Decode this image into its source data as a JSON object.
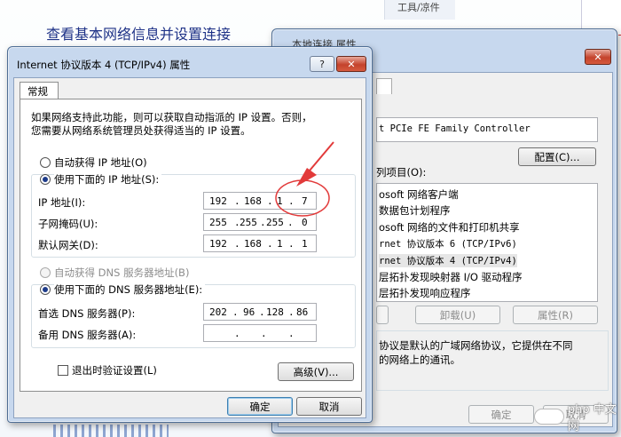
{
  "background": {
    "heading": "查看基本网络信息并设置连接",
    "right_panel_label": "工具/凉件"
  },
  "back_window": {
    "title": "本地连接 属性",
    "title_fragment": "性",
    "adapter_name": "t PCIe FE Family Controller",
    "configure_button": "配置(C)...",
    "items_label": "列项目(O):",
    "items": [
      "osoft 网络客户端",
      "数据包计划程序",
      "osoft 网络的文件和打印机共享",
      "rnet 协议版本 6 (TCP/IPv6)",
      "rnet 协议版本 4 (TCP/IPv4)",
      "层拓扑发现映射器 I/O 驱动程序",
      "层拓扑发现响应程序"
    ],
    "uninstall_button": "卸载(U)",
    "properties_button": "属性(R)",
    "description_line1": "协议是默认的广域网络协议，它提供在不同",
    "description_line2": "的网络上的通讯。",
    "ok_button": "确定",
    "cancel_button": "取消"
  },
  "dialog": {
    "title": "Internet 协议版本 4 (TCP/IPv4) 属性",
    "help_button": "?",
    "close_button": "✕",
    "tab_general": "常规",
    "intro_line1": "如果网络支持此功能，则可以获取自动指派的 IP 设置。否则，",
    "intro_line2": "您需要从网络系统管理员处获得适当的 IP 设置。",
    "auto_ip_label": "自动获得 IP 地址(O)",
    "use_ip_label": "使用下面的 IP 地址(S):",
    "ip_address_label": "IP 地址(I):",
    "ip_address": [
      "192",
      "168",
      "1",
      "7"
    ],
    "subnet_label": "子网掩码(U):",
    "subnet": [
      "255",
      "255",
      "255",
      "0"
    ],
    "gateway_label": "默认网关(D):",
    "gateway": [
      "192",
      "168",
      "1",
      "1"
    ],
    "auto_dns_label": "自动获得 DNS 服务器地址(B)",
    "use_dns_label": "使用下面的 DNS 服务器地址(E):",
    "preferred_dns_label": "首选 DNS 服务器(P):",
    "preferred_dns": [
      "202",
      "96",
      "128",
      "86"
    ],
    "alternate_dns_label": "备用 DNS 服务器(A):",
    "alternate_dns": [
      "",
      "",
      "",
      ""
    ],
    "validate_label": "退出时验证设置(L)",
    "advanced_button": "高级(V)...",
    "ok_button": "确定",
    "cancel_button": "取消"
  },
  "watermark": "php 中文网",
  "colors": {
    "annotation_red": "#e23a3a",
    "title_blue": "#1e3287",
    "window_frame": "#c7d8ee"
  }
}
